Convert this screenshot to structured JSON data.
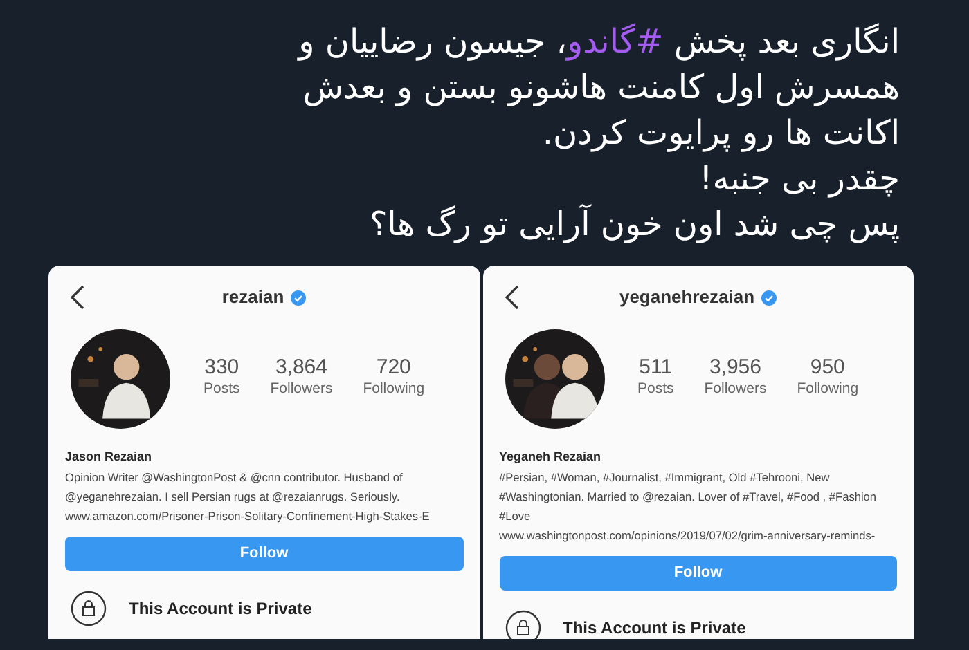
{
  "tweet": {
    "lines": [
      {
        "segments": [
          {
            "kind": "plain",
            "text": "انگاری بعد پخش "
          },
          {
            "kind": "hashtag",
            "text": "#گاندو"
          },
          {
            "kind": "plain",
            "text": "، جیسون رضاییان و"
          }
        ]
      },
      {
        "segments": [
          {
            "kind": "plain",
            "text": "همسرش اول  کامنت هاشونو بستن و بعدش"
          }
        ]
      },
      {
        "segments": [
          {
            "kind": "plain",
            "text": "اکانت ها رو پرایوت کردن."
          }
        ]
      },
      {
        "segments": [
          {
            "kind": "plain",
            "text": "چقدر بی جنبه!"
          }
        ]
      },
      {
        "segments": [
          {
            "kind": "plain",
            "text": "پس چی شد اون خون آرایی تو رگ ها؟"
          }
        ]
      }
    ]
  },
  "profiles": [
    {
      "username": "rezaian",
      "verified": true,
      "avatar": {
        "kind": "picture"
      },
      "stats": [
        {
          "value": "330",
          "label": "Posts"
        },
        {
          "value": "3,864",
          "label": "Followers"
        },
        {
          "value": "720",
          "label": "Following"
        }
      ],
      "name": "Jason Rezaian",
      "bio_lines": [
        "Opinion Writer @WashingtonPost & @cnn contributor. Husband of",
        "@yeganehrezaian. I sell Persian rugs at @rezaianrugs. Seriously."
      ],
      "link": "www.amazon.com/Prisoner-Prison-Solitary-Confinement-High-Stakes-E",
      "follow_button": "Follow",
      "private_notice": "This Account is Private"
    },
    {
      "username": "yeganehrezaian",
      "verified": true,
      "avatar": {
        "kind": "picture"
      },
      "stats": [
        {
          "value": "511",
          "label": "Posts"
        },
        {
          "value": "3,956",
          "label": "Followers"
        },
        {
          "value": "950",
          "label": "Following"
        }
      ],
      "name": "Yeganeh Rezaian",
      "bio_lines": [
        "#Persian, #Woman, #Journalist, #Immigrant, Old #Tehrooni, New",
        "#Washingtonian. Married to @rezaian. Lover of #Travel, #Food , #Fashion",
        "#Love"
      ],
      "link": "www.washingtonpost.com/opinions/2019/07/02/grim-anniversary-reminds-",
      "follow_button": "Follow",
      "private_notice": "This Account is Private"
    }
  ]
}
